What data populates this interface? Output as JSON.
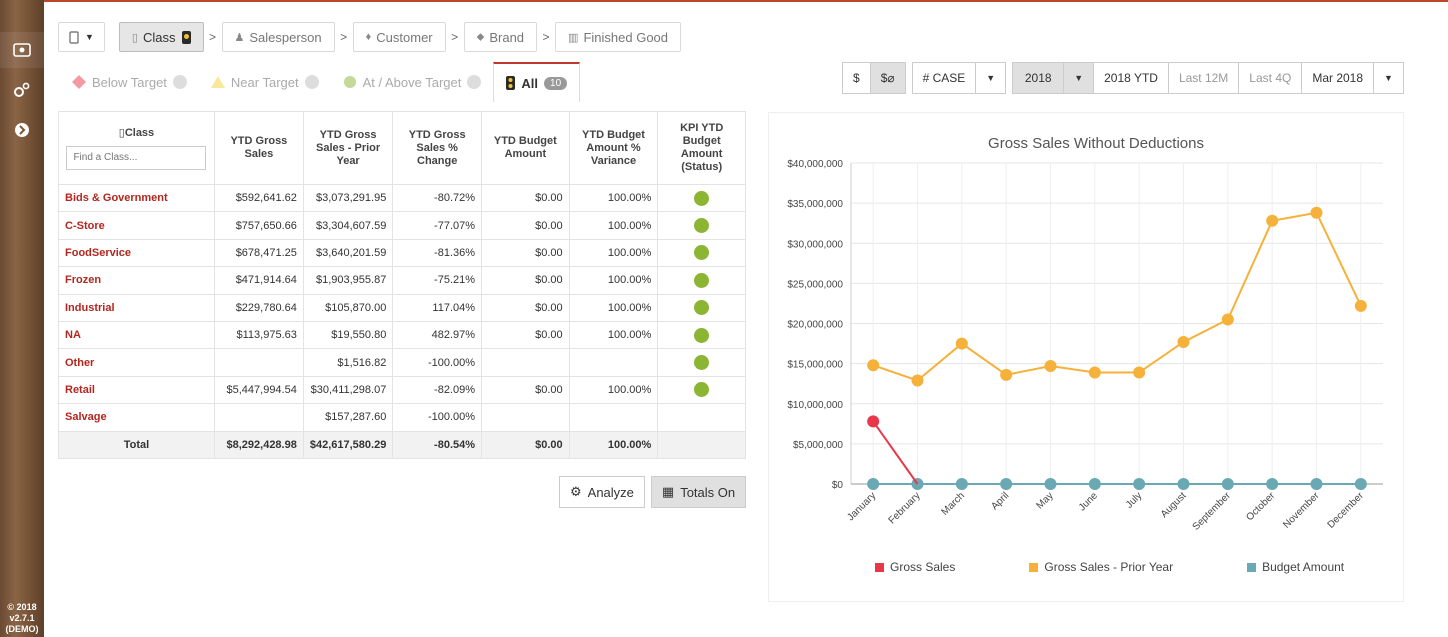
{
  "sidebar": {
    "footer_lines": [
      "© 2018",
      "v2.7.1",
      "(DEMO)"
    ]
  },
  "breadcrumbs": [
    {
      "label": "Class",
      "active": true
    },
    {
      "label": "Salesperson",
      "active": false
    },
    {
      "label": "Customer",
      "active": false
    },
    {
      "label": "Brand",
      "active": false
    },
    {
      "label": "Finished Good",
      "active": false
    }
  ],
  "status_tabs": {
    "below": "Below Target",
    "near": "Near Target",
    "at_above": "At / Above Target",
    "all": "All",
    "all_count": "10"
  },
  "controls": {
    "dollar": "$",
    "dollar_zero": "$⌀",
    "case": "# CASE",
    "year": "2018",
    "ytd": "2018 YTD",
    "last12": "Last 12M",
    "last4q": "Last 4Q",
    "month": "Mar 2018"
  },
  "table": {
    "headers": {
      "class": "Class",
      "find_placeholder": "Find a Class...",
      "ytd_gross": "YTD Gross Sales",
      "ytd_gross_prior": "YTD Gross Sales - Prior Year",
      "ytd_gross_pct": "YTD Gross Sales % Change",
      "ytd_budget": "YTD Budget Amount",
      "ytd_budget_var": "YTD Budget Amount % Variance",
      "kpi": "KPI YTD Budget Amount (Status)"
    },
    "rows": [
      {
        "cls": "Bids & Government",
        "gross": "$592,641.62",
        "prior": "$3,073,291.95",
        "pct": "-80.72%",
        "budget": "$0.00",
        "var": "100.00%",
        "kpi": true
      },
      {
        "cls": "C-Store",
        "gross": "$757,650.66",
        "prior": "$3,304,607.59",
        "pct": "-77.07%",
        "budget": "$0.00",
        "var": "100.00%",
        "kpi": true
      },
      {
        "cls": "FoodService",
        "gross": "$678,471.25",
        "prior": "$3,640,201.59",
        "pct": "-81.36%",
        "budget": "$0.00",
        "var": "100.00%",
        "kpi": true
      },
      {
        "cls": "Frozen",
        "gross": "$471,914.64",
        "prior": "$1,903,955.87",
        "pct": "-75.21%",
        "budget": "$0.00",
        "var": "100.00%",
        "kpi": true
      },
      {
        "cls": "Industrial",
        "gross": "$229,780.64",
        "prior": "$105,870.00",
        "pct": "117.04%",
        "budget": "$0.00",
        "var": "100.00%",
        "kpi": true
      },
      {
        "cls": "NA",
        "gross": "$113,975.63",
        "prior": "$19,550.80",
        "pct": "482.97%",
        "budget": "$0.00",
        "var": "100.00%",
        "kpi": true
      },
      {
        "cls": "Other",
        "gross": "",
        "prior": "$1,516.82",
        "pct": "-100.00%",
        "budget": "",
        "var": "",
        "kpi": true
      },
      {
        "cls": "Retail",
        "gross": "$5,447,994.54",
        "prior": "$30,411,298.07",
        "pct": "-82.09%",
        "budget": "$0.00",
        "var": "100.00%",
        "kpi": true
      },
      {
        "cls": "Salvage",
        "gross": "",
        "prior": "$157,287.60",
        "pct": "-100.00%",
        "budget": "",
        "var": "",
        "kpi": false
      }
    ],
    "total": {
      "label": "Total",
      "gross": "$8,292,428.98",
      "prior": "$42,617,580.29",
      "pct": "-80.54%",
      "budget": "$0.00",
      "var": "100.00%"
    }
  },
  "actions": {
    "analyze": "Analyze",
    "totals": "Totals On"
  },
  "colors": {
    "gross": "#e8374a",
    "prior": "#f5b13a",
    "budget": "#6aa8b4",
    "kpi_green": "#8bb532",
    "accent": "#c0392b"
  },
  "chart_data": {
    "type": "line",
    "title": "Gross Sales Without Deductions",
    "categories": [
      "January",
      "February",
      "March",
      "April",
      "May",
      "June",
      "July",
      "August",
      "September",
      "October",
      "November",
      "December"
    ],
    "y_ticks": [
      "$0",
      "$5,000,000",
      "$10,000,000",
      "$15,000,000",
      "$20,000,000",
      "$25,000,000",
      "$30,000,000",
      "$35,000,000",
      "$40,000,000"
    ],
    "ylim": [
      0,
      40000000
    ],
    "grid": true,
    "legend_position": "bottom",
    "series": [
      {
        "name": "Gross Sales",
        "values": [
          7800000,
          0,
          null,
          null,
          null,
          null,
          null,
          null,
          null,
          null,
          null,
          null
        ]
      },
      {
        "name": "Gross Sales - Prior Year",
        "values": [
          14800000,
          12900000,
          17500000,
          13600000,
          14700000,
          13900000,
          13900000,
          17700000,
          20500000,
          32800000,
          33800000,
          22200000
        ]
      },
      {
        "name": "Budget Amount",
        "values": [
          0,
          0,
          0,
          0,
          0,
          0,
          0,
          0,
          0,
          0,
          0,
          0
        ]
      }
    ]
  }
}
